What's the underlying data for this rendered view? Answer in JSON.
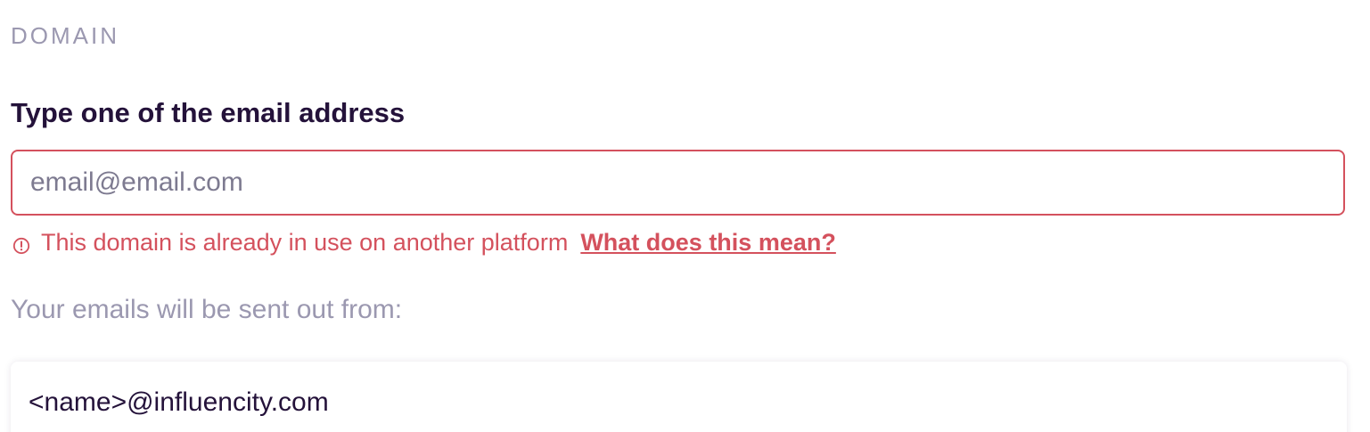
{
  "section": {
    "title": "DOMAIN"
  },
  "email_field": {
    "label": "Type one of the email address",
    "placeholder": "email@email.com",
    "value": ""
  },
  "error": {
    "icon": "alert-circle-icon",
    "message": "This domain is already in use on another platform",
    "link_text": "What does this mean?"
  },
  "sender": {
    "label": "Your emails will be sent out from:",
    "address": "<name>@influencity.com"
  },
  "colors": {
    "error": "#d4515d",
    "heading": "#24123a",
    "muted": "#9b98b0"
  }
}
